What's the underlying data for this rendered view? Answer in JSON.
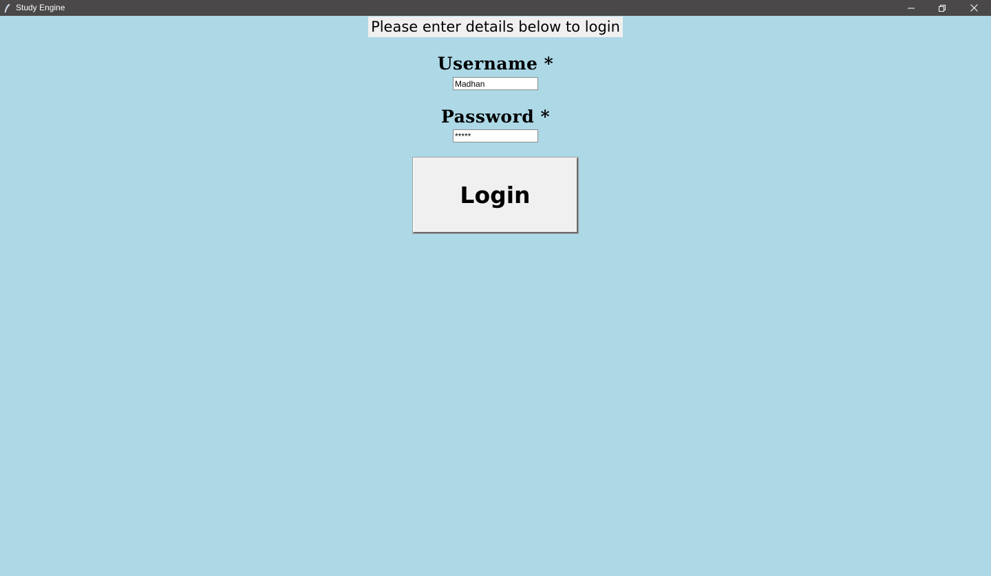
{
  "window": {
    "title": "Study Engine",
    "background_color": "#add8e6",
    "titlebar_color": "#4a4848",
    "controls": {
      "minimize_icon": "minimize-icon",
      "maximize_icon": "restore-icon",
      "close_icon": "close-icon"
    }
  },
  "form": {
    "header": "Please enter details below to login",
    "username_label": "Username *",
    "username_value": "Madhan",
    "password_label": "Password *",
    "password_value": "*****",
    "login_label": "Login"
  }
}
